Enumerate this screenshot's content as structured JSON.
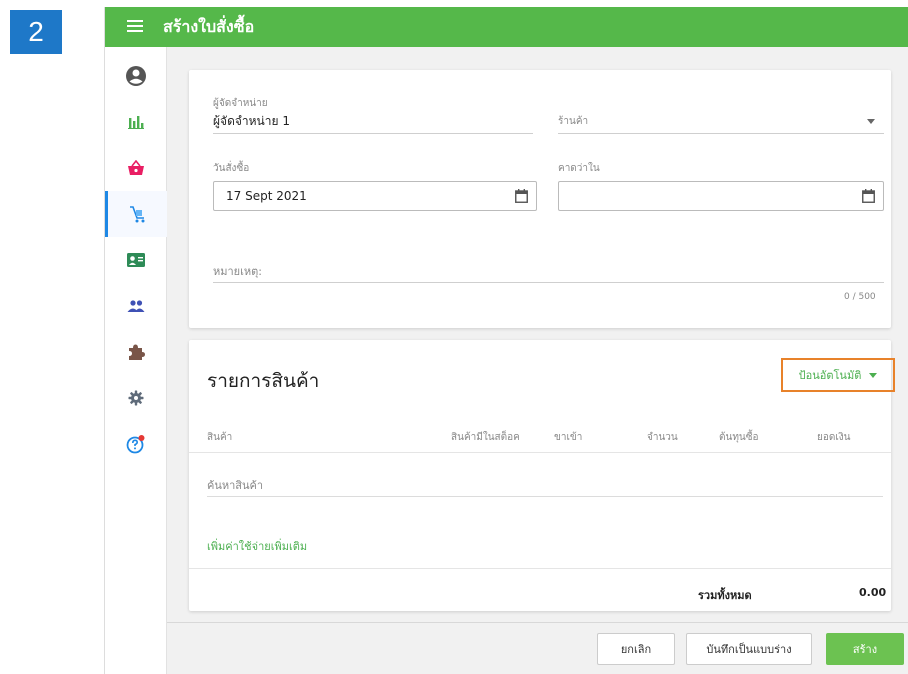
{
  "step_badge": "2",
  "header": {
    "title": "สร้างใบสั่งซื้อ"
  },
  "sidebar": {
    "items": [
      {
        "icon": "account-circle-icon",
        "color": "#555555"
      },
      {
        "icon": "bar-chart-icon",
        "color": "#4caf50"
      },
      {
        "icon": "basket-icon",
        "color": "#e91e63"
      },
      {
        "icon": "purchase-cart-icon",
        "color": "#1e88e5",
        "active": true
      },
      {
        "icon": "contact-card-icon",
        "color": "#2e8b57"
      },
      {
        "icon": "people-icon",
        "color": "#3f51b5"
      },
      {
        "icon": "puzzle-icon",
        "color": "#795548"
      },
      {
        "icon": "gear-icon",
        "color": "#5f6b7a"
      },
      {
        "icon": "help-icon",
        "color": "#1e88e5"
      }
    ]
  },
  "form": {
    "supplier_label": "ผู้จัดจำหน่าย",
    "supplier_value": "ผู้จัดจำหน่าย 1",
    "store_label": "ร้านค้า",
    "order_date_label": "วันสั่งซื้อ",
    "order_date_value": "17 Sept 2021",
    "expected_label": "คาดว่าใน",
    "expected_value": "",
    "note_label": "หมายเหตุ:",
    "note_counter": "0 / 500"
  },
  "items": {
    "title": "รายการสินค้า",
    "auto_fill_label": "ป้อนอัตโนมัติ",
    "columns": [
      "สินค้า",
      "สินค้ามีในสต็อค",
      "ขาเข้า",
      "จำนวน",
      "ต้นทุนซื้อ",
      "ยอดเงิน"
    ],
    "search_placeholder": "ค้นหาสินค้า",
    "add_cost_label": "เพิ่มค่าใช้จ่ายเพิ่มเติม",
    "total_label": "รวมทั้งหมด",
    "total_value": "0.00"
  },
  "actions": {
    "cancel": "ยกเลิก",
    "save_draft": "บันทึกเป็นแบบร่าง",
    "create": "สร้าง"
  },
  "colors": {
    "header": "#55b84a",
    "badge": "#1e78c8",
    "highlight": "#e8822a",
    "create_button": "#6cc251"
  }
}
